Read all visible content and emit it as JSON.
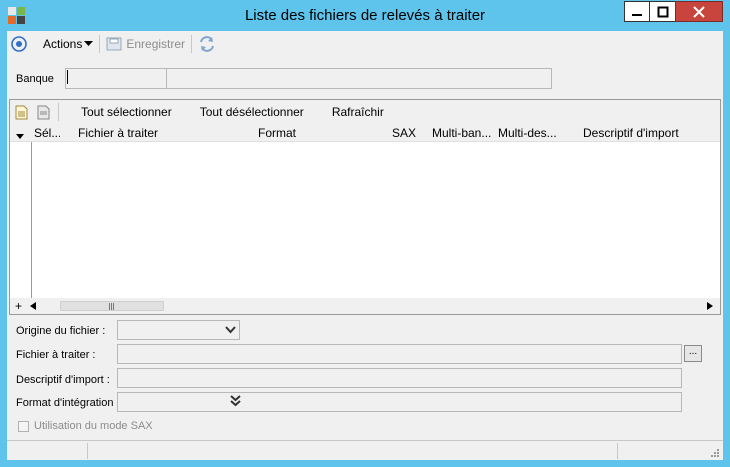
{
  "window": {
    "title": "Liste des fichiers de relevés à traiter",
    "accent_color": "#5ec4ec",
    "close_color": "#c7453c"
  },
  "toolbar": {
    "actions_label": "Actions",
    "save_label": "Enregistrer"
  },
  "bank": {
    "label": "Banque",
    "code_value": "",
    "name_value": ""
  },
  "grid": {
    "toolbar": {
      "select_all": "Tout sélectionner",
      "deselect_all": "Tout désélectionner",
      "refresh": "Rafraîchir"
    },
    "columns": [
      "Sél...",
      "Fichier à traiter",
      "Format",
      "SAX",
      "Multi-ban...",
      "Multi-des...",
      "Descriptif d'import"
    ],
    "rows": [],
    "add_symbol": "+"
  },
  "form": {
    "origin_label": "Origine du fichier :",
    "origin_value": "",
    "file_label": "Fichier à traiter :",
    "file_value": "",
    "browse_label": "...",
    "descriptif_label": "Descriptif d'import :",
    "descriptif_value": "",
    "format_label": "Format d'intégration :",
    "format_value": "",
    "sax_label": "Utilisation du mode SAX",
    "sax_checked": false
  }
}
